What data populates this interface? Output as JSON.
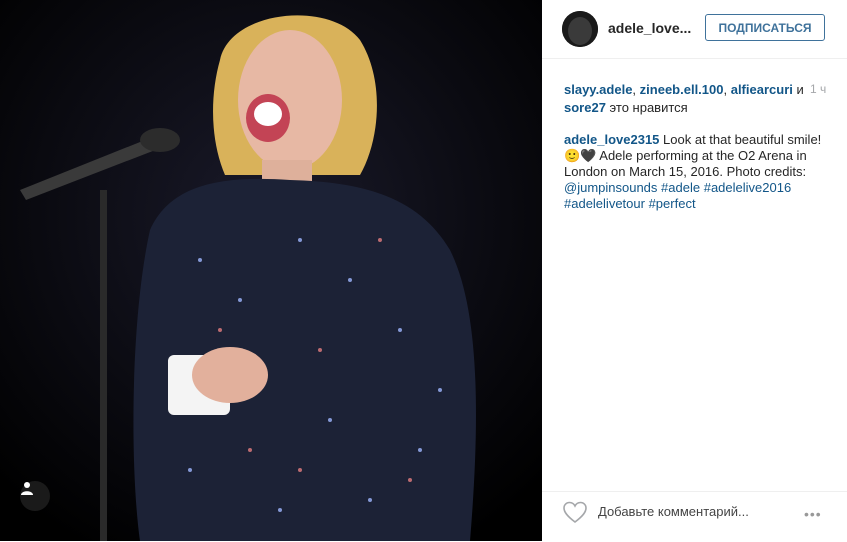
{
  "header": {
    "username": "adele_love...",
    "follow_label": "ПОДПИСАТЬСЯ"
  },
  "likes": {
    "users": [
      "slayy.adele",
      "zineeb.ell.100",
      "alfiearcuri",
      "sore27"
    ],
    "conjunction": "и",
    "suffix": "это нравится",
    "separator": ", "
  },
  "time": "1 ч",
  "caption": {
    "author": "adele_love2315",
    "text": "Look at that beautiful smile! 🙂🖤 Adele performing at the O2 Arena in London on March 15, 2016. Photo credits: ",
    "mention": "@jumpinsounds",
    "hashtags": [
      "#adele",
      "#adelelive2016",
      "#adelelivetour",
      "#perfect"
    ]
  },
  "footer": {
    "comment_placeholder": "Добавьте комментарий...",
    "more_label": "•••"
  },
  "icons": {
    "user_tag": "person-icon",
    "like": "heart-icon",
    "more": "more-options-icon"
  },
  "colors": {
    "link": "#125688",
    "follow": "#3f729b",
    "photo_bg": "#000000"
  }
}
